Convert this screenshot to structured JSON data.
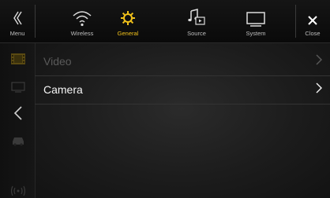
{
  "topbar": {
    "menu": {
      "label": "Menu",
      "icon": "chevron-left-double-icon"
    },
    "tabs": [
      {
        "label": "Wireless",
        "icon": "wifi-icon"
      },
      {
        "label": "General",
        "icon": "gear-icon",
        "active": true
      },
      {
        "label": "Source",
        "icon": "music-note-icon"
      },
      {
        "label": "System",
        "icon": "monitor-icon"
      }
    ],
    "close": {
      "label": "Close",
      "icon": "close-icon"
    }
  },
  "sidebar": {
    "icons": [
      "film-icon",
      "screen-icon",
      "back-chevron-icon",
      "car-icon",
      "radio-waves-icon"
    ]
  },
  "list": {
    "items": [
      {
        "label": "Video",
        "state": "disabled"
      },
      {
        "label": "Camera",
        "state": "enabled"
      }
    ]
  },
  "colors": {
    "accent": "#f2c21a",
    "disabled": "#5a5a5a",
    "text": "#f5f5f5"
  }
}
